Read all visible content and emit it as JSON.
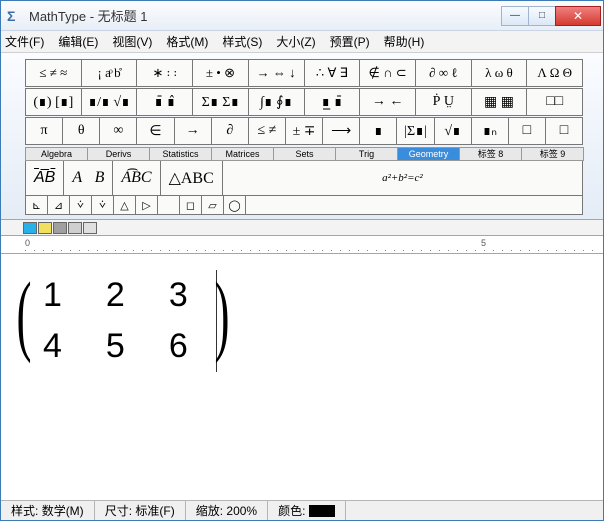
{
  "window": {
    "title": "MathType - 无标题 1",
    "app_icon": "Σ"
  },
  "win_buttons": {
    "minimize": "—",
    "maximize": "□",
    "close": "✕"
  },
  "menu": [
    "文件(F)",
    "编辑(E)",
    "视图(V)",
    "格式(M)",
    "样式(S)",
    "大小(Z)",
    "预置(P)",
    "帮助(H)"
  ],
  "palette": {
    "row1": [
      "≤ ≠ ≈",
      "¡ aͦ b̊",
      "∗ ꞉ ꞉",
      "± • ⊗",
      "→ ⇔ ↓",
      "∴ ∀ ∃",
      "∉ ∩ ⊂",
      "∂ ∞ ℓ",
      "λ ω θ",
      "Λ Ω Θ"
    ],
    "row2": [
      "(∎) [∎]",
      "∎/∎ √∎",
      "∎̄ ∎̂",
      "Σ∎ Σ∎",
      "∫∎ ∮∎",
      "∎̲ ∎̄",
      "→ ←",
      "Ṗ Ṳ",
      "▦ ▦",
      "□□"
    ],
    "row3": [
      "π",
      "θ",
      "∞",
      "∈",
      "→",
      "∂",
      "≤ ≠",
      "± ∓",
      "⟶",
      "∎",
      "|Σ∎|",
      "√∎",
      "∎ₙ",
      "□",
      "□"
    ]
  },
  "tabs": [
    "Algebra",
    "Derivs",
    "Statistics",
    "Matrices",
    "Sets",
    "Trig",
    "Geometry",
    "标签 8",
    "标签 9"
  ],
  "bigrow": [
    "A͞B",
    "A⃗B",
    "A͡BC",
    "△ABC",
    "a²+b²=c²"
  ],
  "smallrow": [
    "⊾",
    "⊿",
    "⩒",
    "⩒",
    "△",
    "▷",
    "",
    "◻",
    "▱",
    "◯",
    "",
    ""
  ],
  "colors": [
    "#28b0e8",
    "#f0e060",
    "#a0a0a0",
    "#cfcfcf",
    "#e0e0e0"
  ],
  "ruler": {
    "left": "0",
    "right": "5"
  },
  "matrix": {
    "rows": [
      [
        "1",
        "2",
        "3"
      ],
      [
        "4",
        "5",
        "6"
      ]
    ]
  },
  "status": {
    "style_label": "样式:",
    "style_value": "数学(M)",
    "size_label": "尺寸:",
    "size_value": "标准(F)",
    "zoom_label": "缩放:",
    "zoom_value": "200%",
    "color_label": "颜色:"
  }
}
